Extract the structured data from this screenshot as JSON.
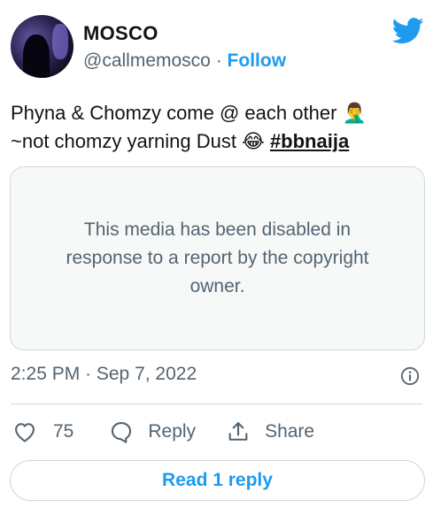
{
  "author": {
    "name": "MOSCO",
    "handle": "@callmemosco",
    "separator": "·",
    "follow_label": "Follow"
  },
  "tweet": {
    "text_line1": "Phyna & Chomzy come @ each other",
    "emoji1": "🤦‍♂️",
    "text_line2": "~not chomzy yarning Dust",
    "emoji2": "😂",
    "hashtag": "#bbnaija"
  },
  "media": {
    "disabled_message": "This media has been disabled in response to a report by the copyright owner."
  },
  "meta": {
    "timestamp": "2:25 PM · Sep 7, 2022"
  },
  "actions": {
    "like_count": "75",
    "reply_label": "Reply",
    "share_label": "Share"
  },
  "read_replies_label": "Read 1 reply",
  "colors": {
    "accent": "#1d9bf0",
    "secondary_text": "#536471",
    "border": "#cfd9de"
  },
  "icons": [
    "twitter-bird-icon",
    "info-icon",
    "heart-icon",
    "reply-bubble-icon",
    "share-icon"
  ]
}
